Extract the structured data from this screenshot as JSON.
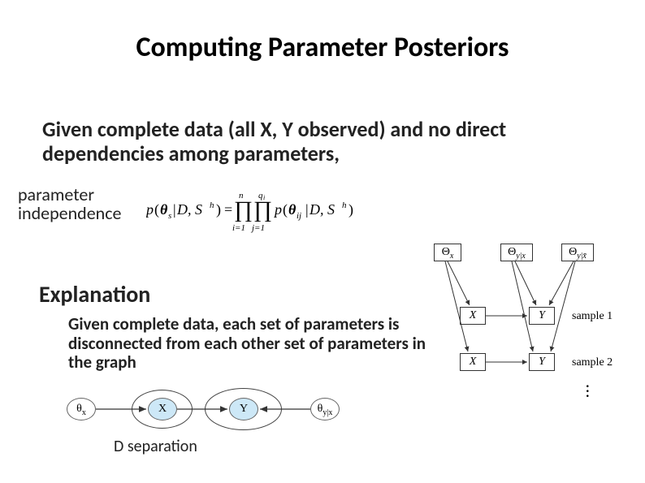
{
  "title": "Computing Parameter Posteriors",
  "para1": "Given complete data (all X, Y observed) and no direct dependencies among parameters,",
  "param_indep": "parameter independence",
  "explanation_h": "Explanation",
  "para2": "Given complete data, each set of parameters is disconnected from each other set of parameters in the graph",
  "dsep": {
    "theta_x": "θ",
    "theta_x_sub": "x",
    "X": "X",
    "Y": "Y",
    "theta_yx": "θ",
    "theta_yx_sub": "y|x",
    "label": "D separation"
  },
  "graph": {
    "Theta_x": "Θ",
    "Theta_x_sub": "x",
    "Theta_yx": "Θ",
    "Theta_yx_sub": "y|x",
    "Theta_ynx": "Θ",
    "Theta_ynx_sub": "y|x̄",
    "X": "X",
    "Y": "Y",
    "sample1": "sample 1",
    "sample2": "sample 2"
  }
}
